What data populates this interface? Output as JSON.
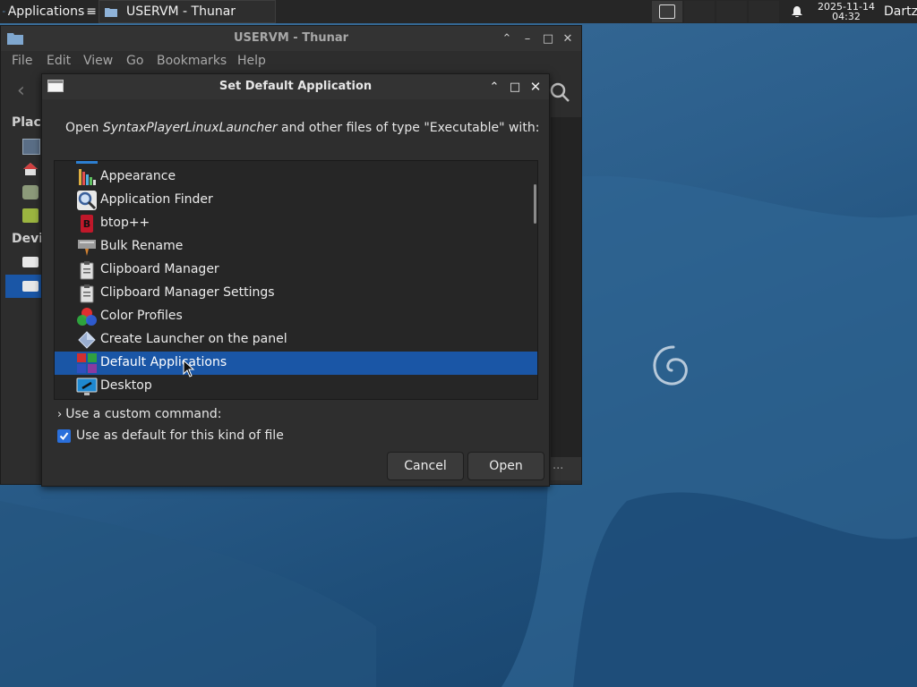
{
  "panel": {
    "apps_label": "Applications",
    "task_label": "USERVM - Thunar",
    "clock_date": "2025-11-14",
    "clock_time": "04:32",
    "user": "Dartz"
  },
  "thunar": {
    "title": "USERVM - Thunar",
    "menu": [
      "File",
      "Edit",
      "View",
      "Go",
      "Bookmarks",
      "Help"
    ],
    "places_label": "Plac",
    "devices_label": "Devi",
    "status_more": "..."
  },
  "dialog": {
    "title": "Set Default Application",
    "prompt_prefix": "Open ",
    "prompt_file": "SyntaxPlayerLinuxLauncher",
    "prompt_suffix": " and other files of type \"Executable\" with:",
    "apps": [
      {
        "label": "Appearance",
        "icon": "appearance-icon"
      },
      {
        "label": "Application Finder",
        "icon": "magnifier-icon"
      },
      {
        "label": "btop++",
        "icon": "btop-icon"
      },
      {
        "label": "Bulk Rename",
        "icon": "bulk-rename-icon"
      },
      {
        "label": "Clipboard Manager",
        "icon": "clipboard-icon"
      },
      {
        "label": "Clipboard Manager Settings",
        "icon": "clipboard-icon"
      },
      {
        "label": "Color Profiles",
        "icon": "color-profiles-icon"
      },
      {
        "label": "Create Launcher on the panel",
        "icon": "launcher-icon"
      },
      {
        "label": "Default Applications",
        "icon": "default-apps-icon",
        "selected": true
      },
      {
        "label": "Desktop",
        "icon": "desktop-icon"
      }
    ],
    "custom_command_label": "Use a custom command:",
    "default_checkbox_label": "Use as default for this kind of file",
    "default_checked": true,
    "cancel_label": "Cancel",
    "open_label": "Open"
  },
  "colors": {
    "selection": "#1a56a6",
    "panel": "#262626",
    "desktop": "#2c5f8c"
  }
}
